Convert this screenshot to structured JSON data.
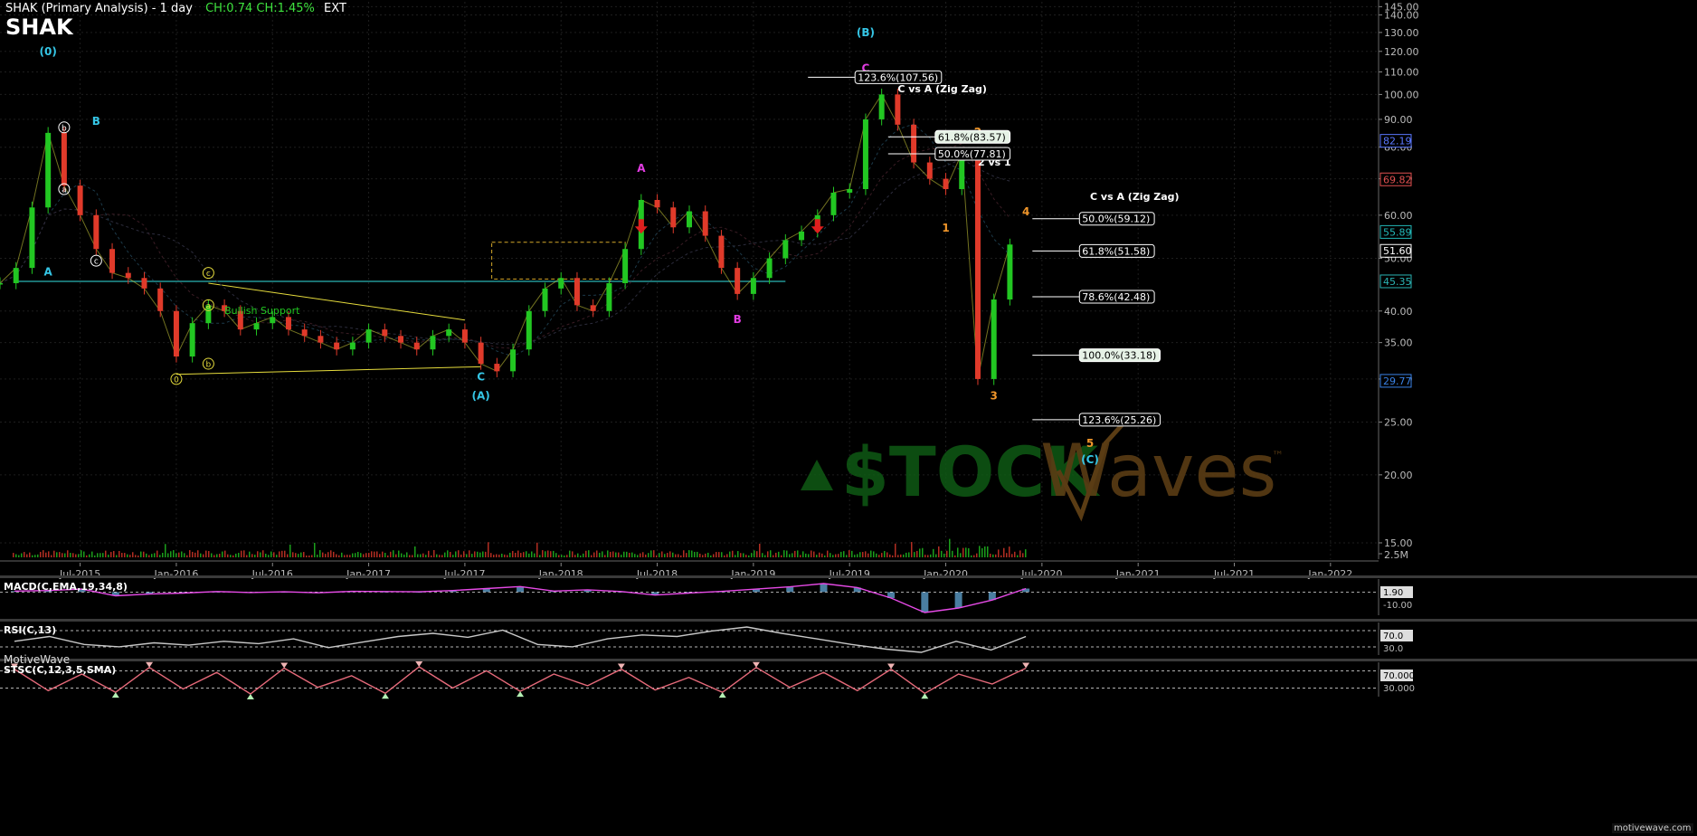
{
  "header": {
    "title": "SHAK (Primary Analysis) - 1 day",
    "change": "CH:0.74  CH:1.45%",
    "ext": "EXT",
    "symbol": "SHAK",
    "footer_brand": "MotiveWave",
    "watermark_url": "motivewave.com"
  },
  "brand": {
    "left": "$TOCK",
    "right": "Waves",
    "trademark": "™"
  },
  "colors": {
    "background": "#000000",
    "up": "#22c722",
    "down": "#e03a2a",
    "cyan": "#35c6e6",
    "magenta": "#e23ce2",
    "orange": "#f0962a",
    "yellow": "#e6dc3c",
    "support": "#2ab4b4",
    "macd": "#e64ae6",
    "macd_hist": "#6ab4e6"
  },
  "chart_data": {
    "type": "line",
    "title": "SHAK (Primary Analysis) - 1 day",
    "y_scale": "log",
    "ylim": [
      14,
      148
    ],
    "y_ticks": [
      145,
      140,
      130,
      120,
      110,
      100,
      90,
      80,
      70,
      60,
      50,
      40,
      35,
      30,
      25,
      20,
      15
    ],
    "y_tick_labels": [
      "145.00",
      "140.00",
      "130.00",
      "120.00",
      "110.00",
      "100.00",
      "90.00",
      "80.00",
      "70.00",
      "60.00",
      "50.00",
      "40.00",
      "35.00",
      "30.00",
      "25.00",
      "20.00",
      "15.00"
    ],
    "x_ticks": [
      "Jul-2015",
      "Jan-2016",
      "Jul-2016",
      "Jan-2017",
      "Jul-2017",
      "Jan-2018",
      "Jul-2018",
      "Jan-2019",
      "Jul-2019",
      "Jan-2020",
      "Jul-2020",
      "Jan-2021",
      "Jul-2021",
      "Jan-2022"
    ],
    "price_series": {
      "name": "SHAK",
      "x": [
        "2015-02",
        "2015-03",
        "2015-04",
        "2015-05",
        "2015-06",
        "2015-07",
        "2015-08",
        "2015-09",
        "2015-10",
        "2015-11",
        "2015-12",
        "2016-01",
        "2016-02",
        "2016-03",
        "2016-04",
        "2016-05",
        "2016-06",
        "2016-07",
        "2016-08",
        "2016-09",
        "2016-10",
        "2016-11",
        "2016-12",
        "2017-01",
        "2017-02",
        "2017-03",
        "2017-04",
        "2017-05",
        "2017-06",
        "2017-07",
        "2017-08",
        "2017-09",
        "2017-10",
        "2017-11",
        "2017-12",
        "2018-01",
        "2018-02",
        "2018-03",
        "2018-04",
        "2018-05",
        "2018-06",
        "2018-07",
        "2018-08",
        "2018-09",
        "2018-10",
        "2018-11",
        "2018-12",
        "2019-01",
        "2019-02",
        "2019-03",
        "2019-04",
        "2019-05",
        "2019-06",
        "2019-07",
        "2019-08",
        "2019-09",
        "2019-10",
        "2019-11",
        "2019-12",
        "2020-01",
        "2020-02",
        "2020-03",
        "2020-04",
        "2020-05"
      ],
      "y": [
        45,
        48,
        62,
        85,
        68,
        60,
        52,
        47,
        46,
        44,
        40,
        33,
        38,
        41,
        40,
        37,
        38,
        39,
        37,
        36,
        35,
        34,
        35,
        37,
        36,
        35,
        34,
        36,
        37,
        35,
        32,
        31,
        34,
        40,
        44,
        46,
        41,
        40,
        45,
        52,
        64,
        62,
        57,
        61,
        55,
        48,
        43,
        46,
        50,
        54,
        56,
        60,
        66,
        67,
        90,
        100,
        88,
        75,
        70,
        67,
        78,
        30,
        42,
        53
      ]
    },
    "price_labels": [
      {
        "value": 82.19,
        "text": "82.19",
        "color": "#5a78ff"
      },
      {
        "value": 69.82,
        "text": "69.82",
        "color": "#e05050"
      },
      {
        "value": 55.89,
        "text": "55.89",
        "color": "#22b8b8"
      },
      {
        "value": 51.6,
        "text": "51.60",
        "color": "#ffffff"
      },
      {
        "value": 45.35,
        "text": "45.35",
        "color": "#2ab4b4"
      },
      {
        "value": 29.77,
        "text": "29.77",
        "color": "#3a82e6"
      }
    ],
    "volume_tick": "2.5M",
    "fib_levels": [
      {
        "text": "123.6%(107.56)",
        "value": 107.56,
        "date": "2019-07",
        "highlight": false
      },
      {
        "text": "61.8%(83.57)",
        "value": 83.57,
        "date": "2019-12",
        "highlight": true
      },
      {
        "text": "50.0%(77.81)",
        "value": 77.81,
        "date": "2019-12",
        "highlight": false
      },
      {
        "text": "50.0%(59.12)",
        "value": 59.12,
        "date": "2020-09",
        "highlight": false
      },
      {
        "text": "61.8%(51.58)",
        "value": 51.58,
        "date": "2020-09",
        "highlight": false
      },
      {
        "text": "78.6%(42.48)",
        "value": 42.48,
        "date": "2020-09",
        "highlight": false
      },
      {
        "text": "100.0%(33.18)",
        "value": 33.18,
        "date": "2020-09",
        "highlight": true
      },
      {
        "text": "123.6%(25.26)",
        "value": 25.26,
        "date": "2020-09",
        "highlight": false
      }
    ],
    "annotations": [
      {
        "text": "C vs A (Zig Zag)",
        "date": "2019-10",
        "value": 101
      },
      {
        "text": "2 vs 1",
        "date": "2020-03",
        "value": 74
      },
      {
        "text": "C vs A (Zig Zag)",
        "date": "2020-10",
        "value": 64
      },
      {
        "text": "Bullish Support",
        "date": "2016-04",
        "value": 39.5,
        "color": "#22c722"
      }
    ],
    "wave_labels": [
      {
        "text": "(0)",
        "date": "2015-05",
        "value": 118,
        "color": "#35c6e6"
      },
      {
        "text": "B",
        "date": "2015-08",
        "value": 88,
        "color": "#35c6e6"
      },
      {
        "text": "A",
        "date": "2015-05",
        "value": 46.5,
        "color": "#35c6e6"
      },
      {
        "text": "C",
        "date": "2017-08",
        "value": 29.8,
        "color": "#35c6e6"
      },
      {
        "text": "(A)",
        "date": "2017-08",
        "value": 27.5,
        "color": "#35c6e6"
      },
      {
        "text": "A",
        "date": "2018-06",
        "value": 72,
        "color": "#e23ce2"
      },
      {
        "text": "B",
        "date": "2018-12",
        "value": 38,
        "color": "#e23ce2"
      },
      {
        "text": "(B)",
        "date": "2019-08",
        "value": 128,
        "color": "#35c6e6"
      },
      {
        "text": "C",
        "date": "2019-08",
        "value": 110,
        "color": "#e23ce2"
      },
      {
        "text": "1",
        "date": "2020-01",
        "value": 56,
        "color": "#f0962a"
      },
      {
        "text": "2",
        "date": "2020-03",
        "value": 84,
        "color": "#f0962a"
      },
      {
        "text": "3",
        "date": "2020-04",
        "value": 27.5,
        "color": "#f0962a"
      },
      {
        "text": "4",
        "date": "2020-06",
        "value": 60,
        "color": "#f0962a"
      },
      {
        "text": "5",
        "date": "2020-10",
        "value": 22.5,
        "color": "#f0962a"
      },
      {
        "text": "(C)",
        "date": "2020-10",
        "value": 21,
        "color": "#35c6e6"
      }
    ],
    "circled_labels": [
      {
        "text": "b",
        "date": "2015-06",
        "value": 87,
        "color": "#ffffff"
      },
      {
        "text": "a",
        "date": "2015-06",
        "value": 67,
        "color": "#ffffff"
      },
      {
        "text": "c",
        "date": "2015-08",
        "value": 49.5,
        "color": "#ffffff"
      },
      {
        "text": "c",
        "date": "2016-03",
        "value": 47,
        "color": "#e6dc3c"
      },
      {
        "text": "a",
        "date": "2016-03",
        "value": 41,
        "color": "#e6dc3c"
      },
      {
        "text": "b",
        "date": "2016-03",
        "value": 32,
        "color": "#e6dc3c"
      },
      {
        "text": "0",
        "date": "2016-01",
        "value": 30,
        "color": "#e6dc3c"
      }
    ],
    "indicators": [
      {
        "name": "MACD(C,EMA,19,34,8)",
        "values": [
          0.4,
          0.6,
          1.2,
          -1.5,
          -0.8,
          -0.4,
          0.2,
          -0.2,
          0.1,
          -0.3,
          0.3,
          0.2,
          0.1,
          0.6,
          1.4,
          2.2,
          0.4,
          0.9,
          0.2,
          -1.2,
          -0.4,
          0.3,
          1.2,
          2.1,
          3.4,
          1.8,
          -2.4,
          -8.2,
          -6.4,
          -3.2,
          1.4
        ],
        "value_label": "1.90",
        "ticks": [
          "-10.00"
        ]
      },
      {
        "name": "RSI(C,13)",
        "values": [
          52,
          58,
          48,
          45,
          50,
          47,
          52,
          49,
          55,
          44,
          51,
          58,
          62,
          57,
          66,
          48,
          45,
          55,
          60,
          58,
          65,
          70,
          62,
          55,
          48,
          42,
          38,
          52,
          41,
          58
        ],
        "value_label": "70.0",
        "ticks": [
          "30.0"
        ]
      },
      {
        "name": "STSC(C,12,3,5,SMA)",
        "values": [
          85,
          20,
          70,
          15,
          90,
          25,
          75,
          10,
          88,
          30,
          65,
          12,
          92,
          28,
          80,
          18,
          70,
          35,
          85,
          22,
          60,
          15,
          90,
          30,
          75,
          20,
          85,
          12,
          70,
          40,
          88
        ],
        "value_label": "70.000",
        "ticks": [
          "30.000"
        ]
      }
    ]
  }
}
